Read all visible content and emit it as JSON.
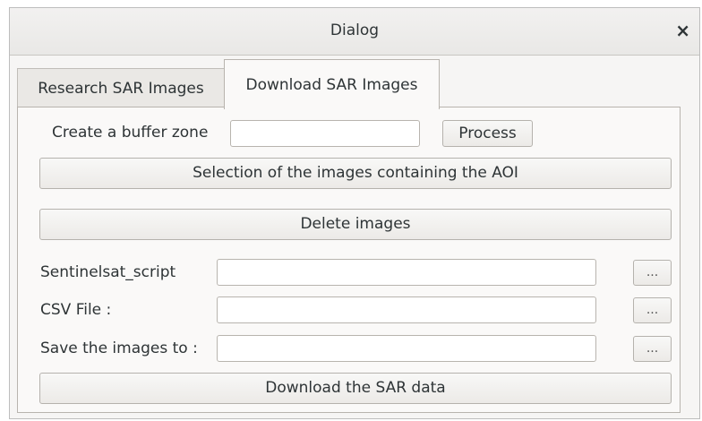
{
  "window": {
    "title": "Dialog",
    "close_label": "×"
  },
  "tabs": [
    {
      "label": "Research SAR Images",
      "active": false
    },
    {
      "label": "Download SAR Images",
      "active": true
    }
  ],
  "buffer": {
    "label": "Create a buffer zone",
    "value": "",
    "process_button": "Process"
  },
  "actions": {
    "select_aoi": "Selection of the images containing the AOI",
    "delete_images": "Delete images",
    "download": "Download the SAR data"
  },
  "fields": [
    {
      "label": "Sentinelsat_script",
      "value": "",
      "browse": "..."
    },
    {
      "label": "CSV File :",
      "value": "",
      "browse": "..."
    },
    {
      "label": "Save the images to :",
      "value": "",
      "browse": "..."
    }
  ]
}
